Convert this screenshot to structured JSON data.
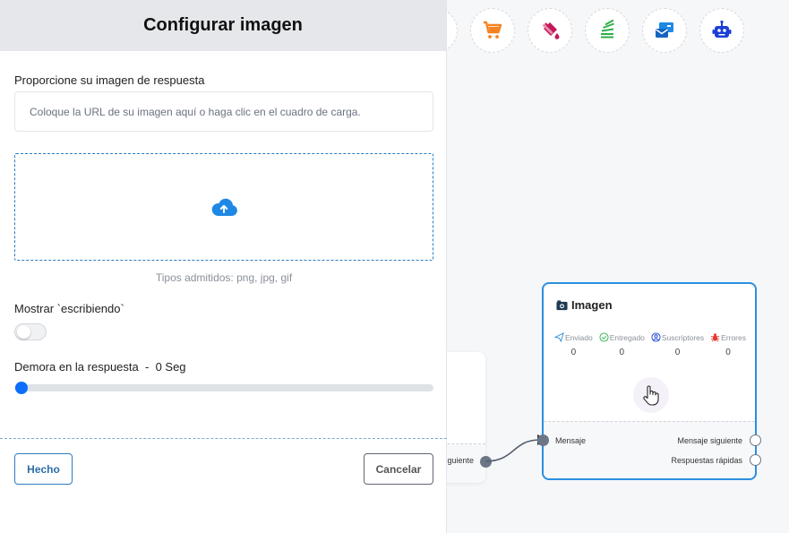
{
  "panel": {
    "title": "Configurar imagen",
    "image_label": "Proporcione su imagen de respuesta",
    "url_placeholder": "Coloque la URL de su imagen aquí o haga clic en el cuadro de carga.",
    "supported_types": "Tipos admitidos: png, jpg, gif",
    "typing_label": "Mostrar `escribiendo`",
    "typing_enabled": false,
    "delay_label": "Demora en la respuesta",
    "delay_value": "0 Seg",
    "delay_separator": "-",
    "done_button": "Hecho",
    "cancel_button": "Cancelar"
  },
  "toolbar": {
    "icons": [
      "cart-icon",
      "paint-bucket-icon",
      "stack-icon",
      "messages-icon",
      "robot-icon"
    ]
  },
  "node_left": {
    "output_label": "iguiente"
  },
  "node_image": {
    "title": "Imagen",
    "stats": [
      {
        "label": "Enviado",
        "value": "0",
        "icon": "send-icon"
      },
      {
        "label": "Entregado",
        "value": "0",
        "icon": "check-circle-icon"
      },
      {
        "label": "Suscriptores",
        "value": "0",
        "icon": "user-circle-icon"
      },
      {
        "label": "Errores",
        "value": "0",
        "icon": "bug-icon"
      }
    ],
    "input_label": "Mensaje",
    "outputs": [
      "Mensaje siguiente",
      "Respuestas rápidas"
    ]
  },
  "colors": {
    "accent": "#2b8fdf",
    "slider": "#0d6efd",
    "cart": "#f58220",
    "paint": "#c2185b",
    "stack": "#2eae4a",
    "messages": "#1e88e5",
    "robot": "#1a3fd6",
    "error": "#e53935"
  }
}
